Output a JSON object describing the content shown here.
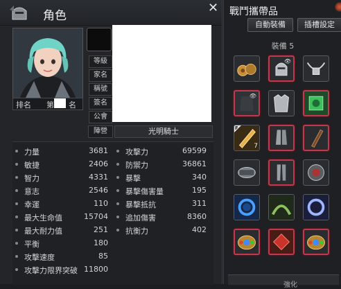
{
  "character_window": {
    "title": "角色",
    "close_label": "✕",
    "rank_label_left": "排名",
    "rank_label_right": "名",
    "rank_label_mid": "第",
    "info_labels": [
      "等級",
      "家名",
      "稱號",
      "簽名",
      "公會"
    ],
    "faction_label": "陣營",
    "faction_value": "光明騎士",
    "stats_left": [
      {
        "label": "力量",
        "value": "3681"
      },
      {
        "label": "敏捷",
        "value": "2406"
      },
      {
        "label": "智力",
        "value": "4331"
      },
      {
        "label": "意志",
        "value": "2546"
      },
      {
        "label": "幸運",
        "value": "110"
      },
      {
        "label": "最大生命值",
        "value": "15704"
      },
      {
        "label": "最大耐力值",
        "value": "251"
      },
      {
        "label": "平衡",
        "value": "180"
      },
      {
        "label": "攻擊速度",
        "value": "85"
      },
      {
        "label": "攻擊力限界突破",
        "value": "11800"
      }
    ],
    "stats_right": [
      {
        "label": "攻擊力",
        "value": "69599"
      },
      {
        "label": "防禦力",
        "value": "36861"
      },
      {
        "label": "暴擊",
        "value": "340"
      },
      {
        "label": "暴擊傷害量",
        "value": "195"
      },
      {
        "label": "暴擊抵抗",
        "value": "311"
      },
      {
        "label": "追加傷害",
        "value": "8360"
      },
      {
        "label": "抗衡力",
        "value": "402"
      }
    ]
  },
  "equipment_window": {
    "title": "戰鬥攜帶品",
    "auto_equip_label": "自動裝備",
    "socket_settings_label": "插槽設定",
    "equip_set_label": "裝備 5",
    "slot_badge_count": "7",
    "slot_tag_letter": "F",
    "bottom_label": "強化"
  },
  "colors": {
    "accent_red": "#c2384d",
    "panel_bg": "#232529"
  }
}
